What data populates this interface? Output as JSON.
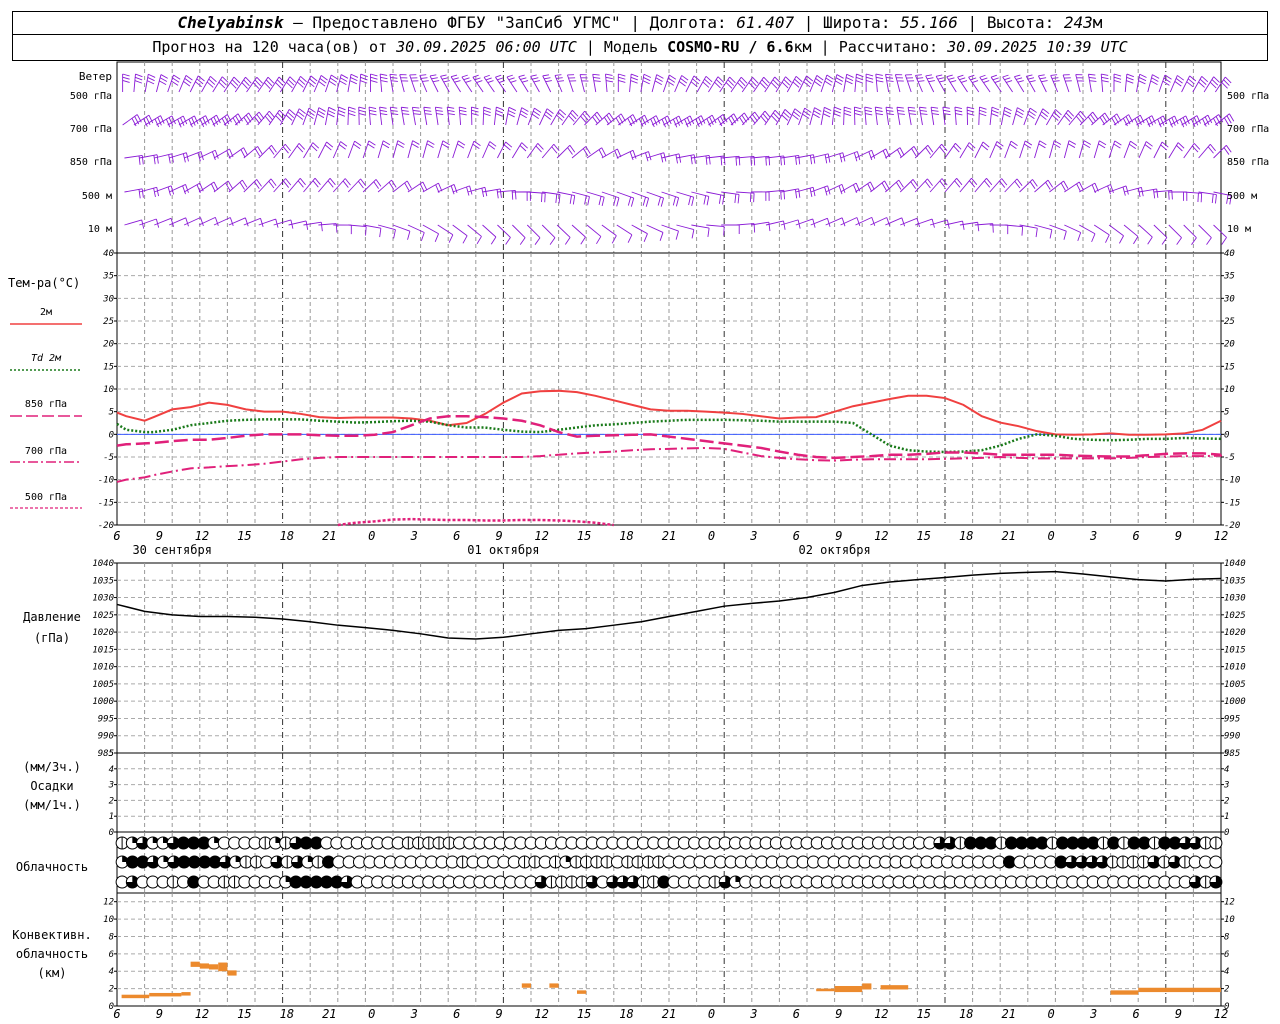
{
  "header": {
    "station": "Chelyabinsk",
    "provided": "— Предоставлено ФГБУ \"ЗапСиб УГМС\"",
    "lon_label": "Долгота:",
    "lon_value": "61.407",
    "lat_label": "Широта:",
    "lat_value": "55.166",
    "alt_label": "Высота:",
    "alt_value": "243",
    "alt_unit": "м",
    "forecast_label": "Прогноз на 120 часа(ов) от",
    "forecast_from": "30.09.2025 06:00 UTC",
    "model_label": "Модель",
    "model_name": "COSMO-RU / 6.6",
    "model_unit": "км",
    "calc_label": "Рассчитано:",
    "calc_value": "30.09.2025 10:39 UTC",
    "sep": "|"
  },
  "wind_panel": {
    "title": "Ветер",
    "levels": [
      "500 гПа",
      "700 гПа",
      "850 гПа",
      "500 м",
      "10 м"
    ],
    "barb_color": "#8a1ad6"
  },
  "temp_panel": {
    "title": "Тем-ра(°С)",
    "legend": [
      {
        "label": "2м",
        "color": "#f04040",
        "dash": "solid"
      },
      {
        "label": "Td 2м",
        "color": "#1a7a1a",
        "dash": "dotted"
      },
      {
        "label": "850 гПа",
        "color": "#e0207a",
        "dash": "long"
      },
      {
        "label": "700 гПа",
        "color": "#e0207a",
        "dash": "dashdot"
      },
      {
        "label": "500 гПа",
        "color": "#e0207a",
        "dash": "short"
      }
    ]
  },
  "pressure_panel": {
    "title1": "Давление",
    "title2": "(гПа)"
  },
  "precip_panel": {
    "line1": "(мм/3ч.)",
    "line2": "Осадки",
    "line3": "(мм/1ч.)"
  },
  "cloud_panel": {
    "title": "Облачность",
    "rows": [
      [
        1,
        2,
        3,
        2,
        2,
        3,
        4,
        4,
        4,
        2,
        0,
        0,
        0,
        0,
        1,
        2,
        1,
        3,
        4,
        4,
        0,
        0,
        0,
        0,
        0,
        0,
        0,
        0,
        1,
        1,
        1,
        1,
        1,
        0,
        0,
        0,
        0,
        0,
        0,
        0,
        0,
        0,
        0,
        0,
        0,
        0,
        0,
        0,
        0,
        0,
        0,
        0,
        0,
        0,
        0,
        0,
        0,
        0,
        0,
        0,
        0,
        0,
        0,
        0,
        0,
        0,
        0,
        0,
        0,
        0,
        0,
        0,
        0,
        0,
        0,
        0,
        0,
        0,
        0,
        0,
        3,
        3,
        1,
        4,
        4,
        4,
        1,
        4,
        4,
        4,
        4,
        1,
        4,
        4,
        4,
        4,
        1,
        4,
        1,
        4,
        4,
        1,
        4,
        4,
        3,
        3,
        1,
        1
      ],
      [
        2,
        4,
        4,
        3,
        2,
        3,
        4,
        4,
        4,
        4,
        3,
        2,
        1,
        1,
        0,
        3,
        1,
        3,
        2,
        1,
        4,
        0,
        0,
        0,
        0,
        0,
        0,
        0,
        0,
        0,
        0,
        0,
        0,
        1,
        0,
        0,
        0,
        0,
        0,
        1,
        1,
        0,
        1,
        2,
        1,
        1,
        1,
        1,
        0,
        1,
        1,
        1,
        1,
        0,
        0,
        0,
        0,
        0,
        0,
        0,
        0,
        0,
        0,
        0,
        0,
        0,
        0,
        0,
        0,
        0,
        0,
        0,
        0,
        0,
        0,
        0,
        0,
        0,
        0,
        0,
        0,
        0,
        0,
        0,
        0,
        0,
        4,
        0,
        0,
        0,
        0,
        4,
        3,
        3,
        3,
        3,
        1,
        1,
        1,
        1,
        3,
        1,
        3,
        1,
        0,
        0,
        0
      ],
      [
        0,
        3,
        0,
        0,
        0,
        1,
        0,
        4,
        0,
        0,
        1,
        1,
        0,
        0,
        0,
        0,
        2,
        4,
        4,
        4,
        4,
        4,
        3,
        0,
        0,
        0,
        0,
        0,
        0,
        0,
        0,
        0,
        0,
        0,
        0,
        0,
        0,
        0,
        0,
        0,
        0,
        3,
        1,
        1,
        1,
        1,
        3,
        0,
        3,
        3,
        3,
        1,
        1,
        4,
        0,
        0,
        0,
        0,
        1,
        3,
        2,
        0,
        0,
        0,
        0,
        0,
        0,
        0,
        0,
        0,
        0,
        0,
        0,
        0,
        0,
        0,
        0,
        0,
        0,
        0,
        0,
        0,
        0,
        0,
        0,
        0,
        0,
        0,
        0,
        0,
        0,
        0,
        0,
        0,
        0,
        0,
        0,
        0,
        0,
        0,
        0,
        0,
        0,
        0,
        0,
        3,
        1,
        3
      ]
    ]
  },
  "conv_panel": {
    "line1": "Конвективн.",
    "line2": "облачность",
    "line3": "(км)",
    "bar_color": "#ec8a2d"
  },
  "x_axis": {
    "hour_labels": [
      "6",
      "9",
      "12",
      "15",
      "18",
      "21",
      "0",
      "3",
      "6",
      "9",
      "12",
      "15",
      "18",
      "21",
      "0",
      "3",
      "6",
      "9",
      "12",
      "15",
      "18",
      "21",
      "0",
      "3",
      "6",
      "9",
      "12"
    ],
    "dates": [
      "30 сентября",
      "01 октября",
      "02 октября"
    ]
  },
  "chart_data": [
    {
      "type": "line",
      "name": "temperature",
      "x_hours": [
        0,
        1,
        3,
        4,
        6,
        8,
        10,
        12,
        14,
        16,
        18,
        20,
        22,
        24,
        26,
        28,
        30,
        32,
        34,
        36,
        38,
        40,
        42,
        44,
        46,
        48,
        50,
        52,
        54,
        56,
        58,
        60,
        62,
        64,
        66,
        68,
        70,
        72,
        74,
        76,
        78,
        80,
        82,
        84,
        86,
        88,
        90,
        92,
        94,
        96,
        98,
        100,
        102,
        104,
        106,
        108,
        110,
        112,
        114,
        116,
        118,
        120
      ],
      "ylim": [
        -20,
        40
      ],
      "yticks": [
        -20,
        -15,
        -10,
        -5,
        0,
        5,
        10,
        15,
        20,
        25,
        30,
        35,
        40
      ],
      "series": [
        {
          "name": "2м",
          "values": [
            4.8,
            4,
            3,
            3.8,
            5.5,
            6,
            7,
            6.5,
            5.5,
            5,
            5,
            4.5,
            3.8,
            3.6,
            3.7,
            3.7,
            3.7,
            3.5,
            3,
            2,
            2.5,
            4.5,
            7,
            9,
            9.5,
            9.6,
            9.3,
            8.5,
            7.5,
            6.5,
            5.5,
            5.2,
            5.2,
            5,
            4.8,
            4.5,
            4,
            3.5,
            3.7,
            3.8,
            5,
            6.2,
            7,
            7.8,
            8.5,
            8.5,
            8,
            6.5,
            4,
            2.6,
            1.8,
            0.7,
            0,
            -0.1,
            0,
            0.2,
            -0.1,
            -0.1,
            0,
            0.2,
            1,
            3
          ]
        },
        {
          "name": "Td 2м",
          "values": [
            2.3,
            1,
            0.5,
            0.5,
            1,
            2,
            2.5,
            3,
            3.2,
            3.3,
            3.3,
            3.3,
            3,
            2.8,
            2.6,
            2.7,
            2.9,
            3,
            2.8,
            2,
            1.5,
            1.5,
            1,
            0.6,
            0.5,
            1,
            1.5,
            2,
            2.2,
            2.5,
            2.8,
            3,
            3.2,
            3.2,
            3.2,
            3.1,
            3,
            2.8,
            2.8,
            2.8,
            2.8,
            2.5,
            0,
            -2.5,
            -3.5,
            -3.8,
            -3.9,
            -3.8,
            -3.5,
            -2.5,
            -1,
            0,
            -0.3,
            -1,
            -1.2,
            -1.3,
            -1.2,
            -1,
            -1,
            -0.8,
            -0.9,
            -1,
            -1
          ]
        },
        {
          "name": "850 гПа",
          "values": [
            -2.5,
            -2.2,
            -2,
            -1.9,
            -1.5,
            -1.2,
            -1.2,
            -0.8,
            -0.3,
            0,
            0,
            0,
            -0.2,
            -0.3,
            -0.3,
            -0.1,
            0.5,
            2,
            3.5,
            4,
            4,
            3.8,
            3.5,
            3,
            2,
            0.5,
            -0.5,
            -0.3,
            -0.2,
            -0.1,
            0,
            -0.5,
            -1,
            -1.5,
            -2,
            -2.5,
            -3,
            -3.8,
            -4.5,
            -5,
            -5.2,
            -5,
            -4.8,
            -4.5,
            -4.5,
            -4.3,
            -4,
            -4,
            -4.2,
            -4.5,
            -4.5,
            -4.5,
            -4.5,
            -4.7,
            -4.8,
            -4.9,
            -4.9,
            -4.6,
            -4.3,
            -4.2,
            -4.2,
            -4.5,
            -4.5
          ]
        },
        {
          "name": "700 гПа",
          "values": [
            -10.5,
            -10,
            -9.5,
            -9,
            -8.2,
            -7.5,
            -7.3,
            -7,
            -6.8,
            -6.5,
            -6,
            -5.5,
            -5.2,
            -5,
            -5,
            -5,
            -5,
            -5,
            -5,
            -5,
            -5,
            -5,
            -5,
            -5,
            -4.8,
            -4.5,
            -4.2,
            -4,
            -3.8,
            -3.5,
            -3.3,
            -3.2,
            -3.1,
            -3,
            -3.2,
            -4,
            -4.8,
            -5.2,
            -5.5,
            -5.7,
            -5.8,
            -5.6,
            -5.5,
            -5.5,
            -5.5,
            -5.5,
            -5.4,
            -5.3,
            -5.2,
            -5,
            -5.2,
            -5.3,
            -5.3,
            -5.3,
            -5.3,
            -5.3,
            -5.2,
            -5,
            -4.9,
            -4.8,
            -4.8,
            -4.7,
            -4.5
          ]
        },
        {
          "name": "500 гПа",
          "x_hours": [
            24,
            26,
            28,
            30,
            32,
            34,
            36,
            38,
            40,
            42,
            44,
            46,
            48,
            50,
            52,
            54
          ],
          "values": [
            -20,
            -19.5,
            -19.2,
            -18.8,
            -18.7,
            -18.8,
            -18.9,
            -18.9,
            -19,
            -19,
            -18.9,
            -18.9,
            -19,
            -19.2,
            -19.5,
            -20
          ]
        }
      ]
    },
    {
      "type": "line",
      "name": "pressure",
      "ylim": [
        985,
        1040
      ],
      "yticks": [
        985,
        990,
        995,
        1000,
        1005,
        1010,
        1015,
        1020,
        1025,
        1030,
        1035,
        1040
      ],
      "x_hours": [
        0,
        3,
        6,
        9,
        12,
        15,
        18,
        21,
        24,
        27,
        30,
        33,
        36,
        39,
        42,
        45,
        48,
        51,
        54,
        57,
        60,
        63,
        66,
        69,
        72,
        75,
        78,
        81,
        84,
        87,
        90,
        93,
        96,
        99,
        102,
        105,
        108,
        111,
        114,
        117,
        120
      ],
      "values": [
        1028,
        1026,
        1025,
        1024.5,
        1024.5,
        1024.3,
        1023.8,
        1023,
        1022,
        1021.3,
        1020.5,
        1019.5,
        1018.3,
        1018,
        1018.5,
        1019.5,
        1020.5,
        1021,
        1022,
        1023,
        1024.5,
        1026,
        1027.5,
        1028.3,
        1029,
        1030,
        1031.5,
        1033.5,
        1034.5,
        1035.2,
        1035.8,
        1036.5,
        1037,
        1037.3,
        1037.5,
        1036.8,
        1036,
        1035.2,
        1034.8,
        1035.3,
        1035.5
      ]
    },
    {
      "type": "bar",
      "name": "convective_cloud",
      "ylim": [
        0,
        13
      ],
      "yticks": [
        0,
        2,
        4,
        6,
        8,
        10,
        12
      ],
      "segments": [
        {
          "from": 0.5,
          "to": 3.5,
          "low": 0.9,
          "high": 1.3
        },
        {
          "from": 3.5,
          "to": 7,
          "low": 1.1,
          "high": 1.5
        },
        {
          "from": 7,
          "to": 8,
          "low": 1.2,
          "high": 1.6
        },
        {
          "from": 8,
          "to": 9,
          "low": 4.5,
          "high": 5.1
        },
        {
          "from": 9,
          "to": 10,
          "low": 4.3,
          "high": 4.9
        },
        {
          "from": 10,
          "to": 11,
          "low": 4.2,
          "high": 4.8
        },
        {
          "from": 11,
          "to": 12,
          "low": 4.0,
          "high": 5.0
        },
        {
          "from": 12,
          "to": 13,
          "low": 3.5,
          "high": 4.1
        },
        {
          "from": 44,
          "to": 45,
          "low": 2.1,
          "high": 2.6
        },
        {
          "from": 47,
          "to": 48,
          "low": 2.1,
          "high": 2.6
        },
        {
          "from": 50,
          "to": 51,
          "low": 1.4,
          "high": 1.8
        },
        {
          "from": 76,
          "to": 78,
          "low": 1.7,
          "high": 2.0
        },
        {
          "from": 78,
          "to": 81,
          "low": 1.6,
          "high": 2.3
        },
        {
          "from": 81,
          "to": 82,
          "low": 1.9,
          "high": 2.6
        },
        {
          "from": 83,
          "to": 86,
          "low": 1.9,
          "high": 2.4
        },
        {
          "from": 108,
          "to": 111,
          "low": 1.3,
          "high": 1.8
        },
        {
          "from": 111,
          "to": 120,
          "low": 1.6,
          "high": 2.1
        }
      ]
    },
    {
      "type": "bar",
      "name": "precipitation",
      "ylim": [
        0,
        5
      ],
      "yticks": [
        0,
        1,
        2,
        3,
        4,
        5
      ],
      "values": []
    }
  ]
}
